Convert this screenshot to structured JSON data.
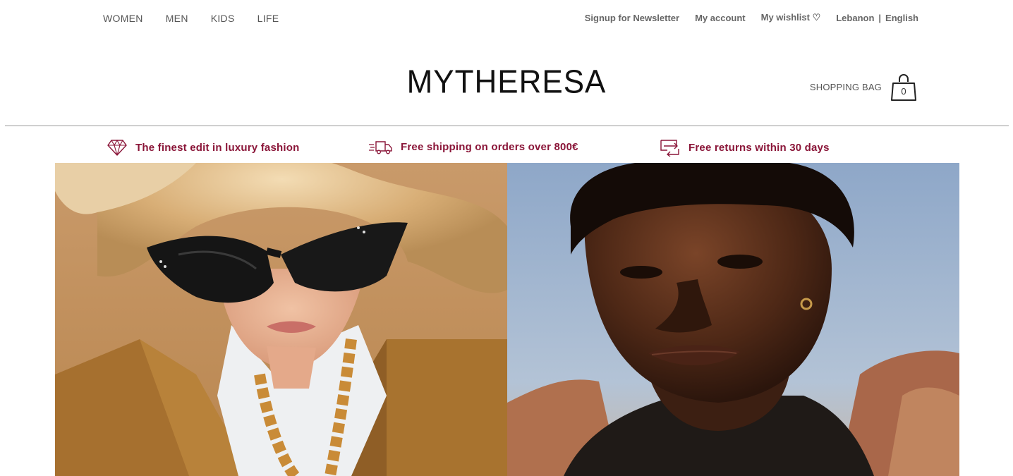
{
  "nav": {
    "departments": [
      "WOMEN",
      "MEN",
      "KIDS",
      "LIFE"
    ],
    "newsletter": "Signup for Newsletter",
    "account": "My account",
    "wishlist": "My wishlist ♡",
    "country": "Lebanon",
    "separator": "|",
    "language": "English"
  },
  "header": {
    "logo": "MYTHERESA",
    "bag_label": "SHOPPING BAG",
    "bag_count": "0"
  },
  "usps": [
    {
      "icon": "diamond-icon",
      "text": "The finest edit in luxury fashion"
    },
    {
      "icon": "truck-icon",
      "text": "Free shipping on orders over 800€"
    },
    {
      "icon": "returns-icon",
      "text": "Free returns within 30 days"
    }
  ],
  "colors": {
    "accent": "#8a1538",
    "text": "#555555",
    "logo": "#111111"
  }
}
